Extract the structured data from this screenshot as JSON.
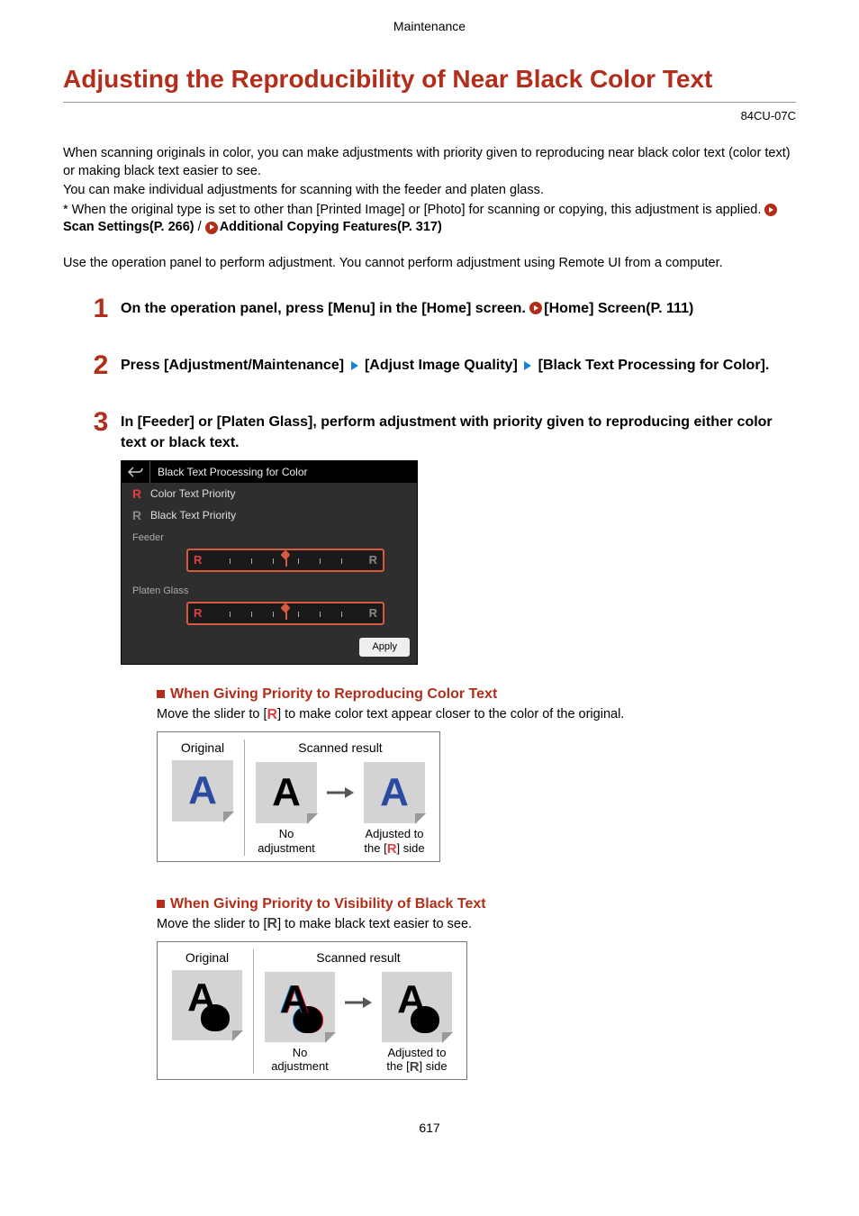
{
  "header": {
    "section": "Maintenance"
  },
  "title": "Adjusting the Reproducibility of Near Black Color Text",
  "doc_code": "84CU-07C",
  "intro": {
    "p1": "When scanning originals in color, you can make adjustments with priority given to reproducing near black color text (color text) or making black text easier to see.",
    "p2": "You can make individual adjustments for scanning with the feeder and platen glass.",
    "p3_prefix": "* When the original type is set to other than [Printed Image] or [Photo] for scanning or copying, this adjustment is applied. ",
    "link1": "Scan Settings(P. 266)",
    "sep": " / ",
    "link2": "Additional Copying Features(P. 317)"
  },
  "note": "Use the operation panel to perform adjustment. You cannot perform adjustment using Remote UI from a computer.",
  "steps": [
    {
      "num": "1",
      "text_prefix": "On the operation panel, press [Menu] in the [Home] screen. ",
      "link": "[Home] Screen(P. 111)"
    },
    {
      "num": "2",
      "path": [
        "Press [Adjustment/Maintenance]",
        "[Adjust Image Quality]",
        "[Black Text Processing for Color]."
      ]
    },
    {
      "num": "3",
      "text": "In [Feeder] or [Platen Glass], perform adjustment with priority given to reproducing either color text or black text."
    }
  ],
  "panel": {
    "title": "Black Text Processing for Color",
    "legend_color": "Color Text Priority",
    "legend_black": "Black Text Priority",
    "feeder": "Feeder",
    "platen": "Platen Glass",
    "apply": "Apply"
  },
  "sub1": {
    "title": "When Giving Priority to Reproducing Color Text",
    "desc_a": "Move the slider to [",
    "desc_b": "] to make color text appear closer to the color of the original."
  },
  "sub2": {
    "title": "When Giving Priority to Visibility of Black Text",
    "desc_a": "Move the slider to [",
    "desc_b": "] to make black text easier to see."
  },
  "diagram": {
    "original": "Original",
    "scanned": "Scanned result",
    "no_adj_l1": "No",
    "no_adj_l2": "adjustment",
    "adj_l1": "Adjusted to",
    "adj_l2_a": "the [",
    "adj_l2_b": "] side"
  },
  "page_num": "617"
}
